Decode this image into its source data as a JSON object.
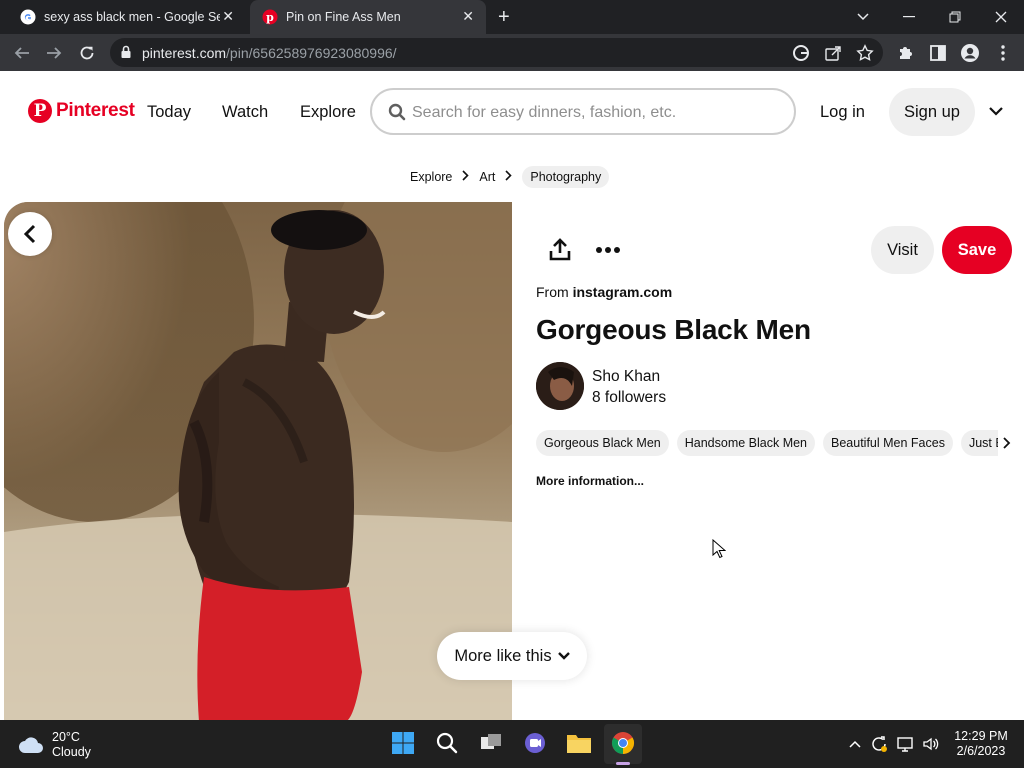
{
  "browser": {
    "tabs": [
      {
        "title": "sexy ass black men - Google Sear",
        "icon": "google-icon"
      },
      {
        "title": "Pin on Fine Ass Men",
        "icon": "pinterest-icon",
        "active": true
      }
    ],
    "url_host": "pinterest.com",
    "url_path": "/pin/656258976923080996/"
  },
  "header": {
    "logo_text": "Pinterest",
    "nav": [
      "Today",
      "Watch",
      "Explore"
    ],
    "search_placeholder": "Search for easy dinners, fashion, etc.",
    "login": "Log in",
    "signup": "Sign up"
  },
  "breadcrumb": [
    "Explore",
    "Art",
    "Photography"
  ],
  "pin": {
    "visit": "Visit",
    "save": "Save",
    "from_prefix": "From",
    "from_source": "instagram.com",
    "title": "Gorgeous Black Men",
    "user_name": "Sho Khan",
    "followers": "8 followers",
    "tags": [
      "Gorgeous Black Men",
      "Handsome Black Men",
      "Beautiful Men Faces",
      "Just Beautiful Men"
    ],
    "more_info": "More information...",
    "more_like_this": "More like this"
  },
  "taskbar": {
    "temperature": "20°C",
    "condition": "Cloudy",
    "time": "12:29 PM",
    "date": "2/6/2023"
  },
  "colors": {
    "pinterest_red": "#e60023",
    "chrome_dark": "#202124",
    "chrome_toolbar": "#35363a",
    "taskbar": "#202020"
  }
}
